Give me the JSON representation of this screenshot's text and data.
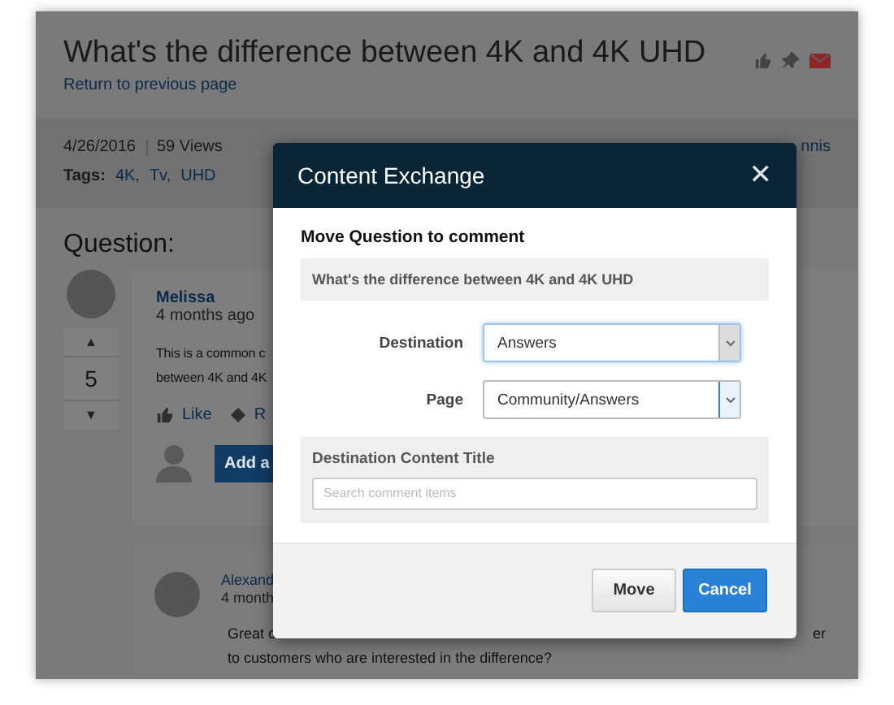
{
  "page": {
    "title": "What's the difference between 4K and 4K UHD",
    "back_link": "Return to previous page",
    "date": "4/26/2016",
    "views": "59 Views",
    "tags_label": "Tags:",
    "tags": [
      "4K,",
      "Tv,",
      "UHD"
    ],
    "author_link": "nnis"
  },
  "question": {
    "heading": "Question:",
    "author": "Melissa",
    "time": "4 months ago",
    "vote_up": "▲",
    "votes": "5",
    "vote_down": "▼",
    "body": [
      "This is a common c",
      "between 4K and 4K"
    ],
    "like": "Like",
    "reply": "R",
    "add_button": "Add a"
  },
  "comment": {
    "author": "Alexand",
    "time": "4 month",
    "line_1": "Great c",
    "line_1_end": "er",
    "line_2": "to customers who are interested in the difference?"
  },
  "dialog": {
    "title": "Content Exchange",
    "close": "✕",
    "heading": "Move Question to comment",
    "question": "What's the difference between 4K and 4K UHD",
    "selects": [
      {
        "label": "Destination",
        "value": "Answers",
        "focused": true
      },
      {
        "label": "Page",
        "value": "Community/Answers",
        "focused": false
      }
    ],
    "target_label": "Destination Content Title",
    "target_placeholder": "Search comment items",
    "buttons": [
      {
        "label": "Move",
        "kind": "secondary"
      },
      {
        "label": "Cancel",
        "kind": "primary"
      }
    ]
  }
}
